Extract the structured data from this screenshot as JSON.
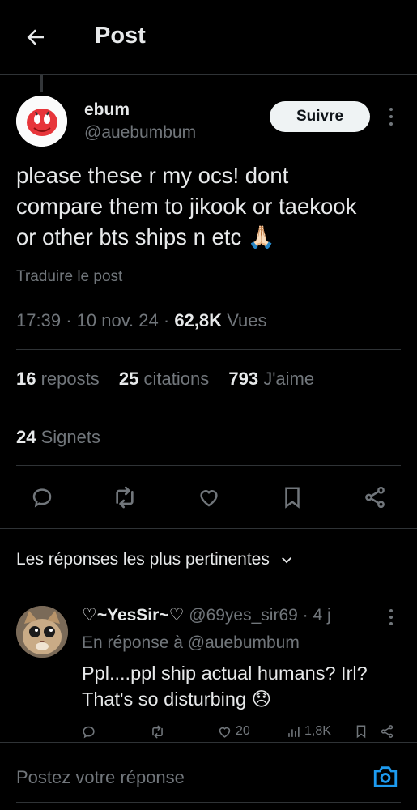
{
  "header": {
    "title": "Post"
  },
  "author": {
    "name": "ebum",
    "handle": "@auebumbum",
    "follow_label": "Suivre"
  },
  "post": {
    "line1": "please these r my ocs! dont",
    "line2": "compare them to jikook or taekook",
    "line3": "or other bts ships n etc",
    "emoji": "🙏🏻",
    "translate_label": "Traduire le post",
    "time": "17:39",
    "date": "10 nov. 24",
    "views_count": "62,8K",
    "views_label": "Vues",
    "separator": "·"
  },
  "stats": {
    "reposts_count": "16",
    "reposts_label": "reposts",
    "quotes_count": "25",
    "quotes_label": "citations",
    "likes_count": "793",
    "likes_label": "J'aime",
    "bookmarks_count": "24",
    "bookmarks_label": "Signets"
  },
  "actions": [
    "reply-icon",
    "repost-icon",
    "like-icon",
    "bookmark-icon",
    "share-icon"
  ],
  "replies_sort": {
    "label": "Les réponses les plus pertinentes"
  },
  "reply": {
    "name": "♡~YesSir~♡",
    "handle": "@69yes_sir69",
    "age": "4 j",
    "separator": "·",
    "in_reply_to_label": "En réponse à",
    "in_reply_to_handle": "@auebumbum",
    "text_line1": "Ppl....ppl ship actual humans? Irl?",
    "text_line2": "That's so disturbing",
    "emoji": "😞",
    "likes": "20",
    "views": "1,8K"
  },
  "compose": {
    "placeholder": "Postez votre réponse"
  },
  "colors": {
    "background": "#000000",
    "text": "#e7e9ea",
    "muted": "#71767b",
    "accent": "#1d9bf0",
    "divider": "#2f3336"
  }
}
